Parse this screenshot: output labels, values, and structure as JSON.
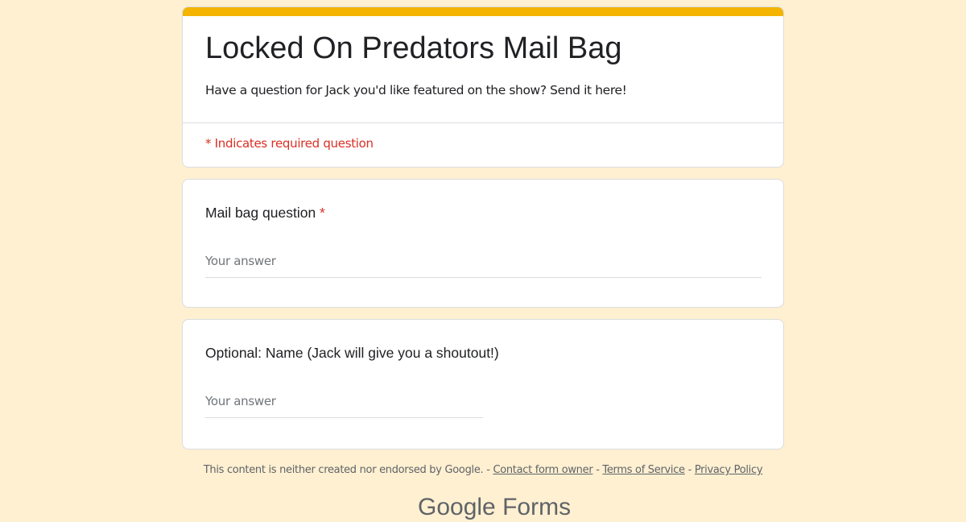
{
  "form": {
    "title": "Locked On Predators Mail Bag",
    "description": "Have a question for Jack you'd like featured on the show? Send it here!",
    "required_note": "* Indicates required question",
    "accent_color": "#f4b400"
  },
  "questions": [
    {
      "label": "Mail bag question",
      "required_marker": "*",
      "placeholder": "Your answer",
      "value": ""
    },
    {
      "label": "Optional: Name (Jack will give you a shoutout!)",
      "placeholder": "Your answer",
      "value": ""
    }
  ],
  "footer": {
    "disclaimer": "This content is neither created nor endorsed by Google.",
    "separator": " - ",
    "contact_link": "Contact form owner",
    "terms_link": "Terms of Service",
    "privacy_link": "Privacy Policy"
  },
  "brand": {
    "logo_text": "Google Forms"
  },
  "colors": {
    "background": "#fff0d1",
    "required": "#d93025"
  }
}
